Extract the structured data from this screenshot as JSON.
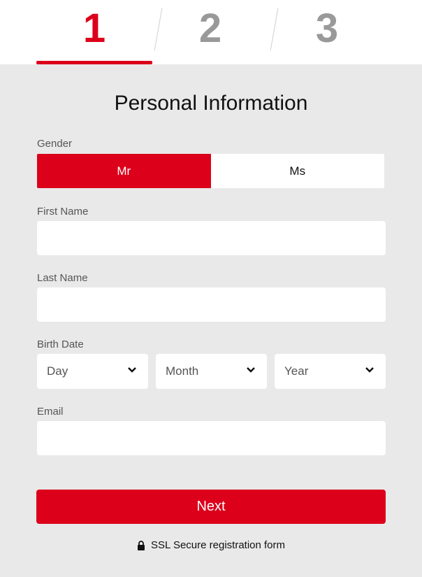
{
  "steps": [
    {
      "number": "1",
      "active": true
    },
    {
      "number": "2",
      "active": false
    },
    {
      "number": "3",
      "active": false
    }
  ],
  "form": {
    "title": "Personal Information",
    "gender": {
      "label": "Gender",
      "options": [
        "Mr",
        "Ms"
      ],
      "selected": "Mr"
    },
    "first_name": {
      "label": "First Name",
      "value": "",
      "placeholder": ""
    },
    "last_name": {
      "label": "Last Name",
      "value": "",
      "placeholder": ""
    },
    "birth_date": {
      "label": "Birth Date",
      "day": "Day",
      "month": "Month",
      "year": "Year"
    },
    "email": {
      "label": "Email",
      "value": "",
      "placeholder": ""
    },
    "next_label": "Next",
    "ssl_text": "SSL Secure registration form"
  },
  "colors": {
    "accent": "#dc001b",
    "background": "#e9e9e9",
    "inactive_step": "#999999"
  },
  "icons": {
    "lock": "lock-icon",
    "dropdown": "chevron-down-icon"
  }
}
